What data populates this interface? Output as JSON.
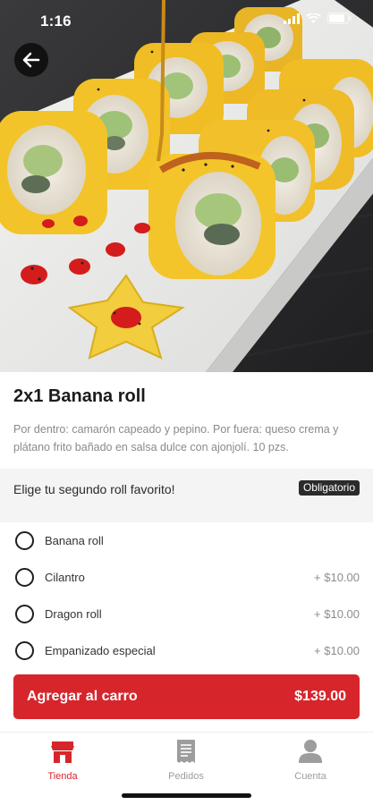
{
  "status_bar": {
    "time": "1:16"
  },
  "product": {
    "title": "2x1 Banana roll",
    "description": "Por dentro: camarón capeado y pepino. Por fuera: queso crema y plátano frito bañado en salsa dulce con ajonjolí. 10 pzs."
  },
  "option_group": {
    "label": "Elige tu segundo roll favorito!",
    "badge": "Obligatorio",
    "options": [
      {
        "label": "Banana roll",
        "price": ""
      },
      {
        "label": "Cilantro",
        "price": "+ $10.00"
      },
      {
        "label": "Dragon roll",
        "price": "+ $10.00"
      },
      {
        "label": "Empanizado especial",
        "price": "+ $10.00"
      }
    ]
  },
  "cart_button": {
    "label": "Agregar al carro",
    "price": "$139.00"
  },
  "tab_bar": {
    "tabs": [
      {
        "label": "Tienda",
        "icon": "store-icon",
        "active": true
      },
      {
        "label": "Pedidos",
        "icon": "receipt-icon",
        "active": false
      },
      {
        "label": "Cuenta",
        "icon": "person-icon",
        "active": false
      }
    ]
  },
  "colors": {
    "accent": "#d7252c",
    "badge": "#2b2b2b",
    "option_header_bg": "#f4f4f4"
  }
}
